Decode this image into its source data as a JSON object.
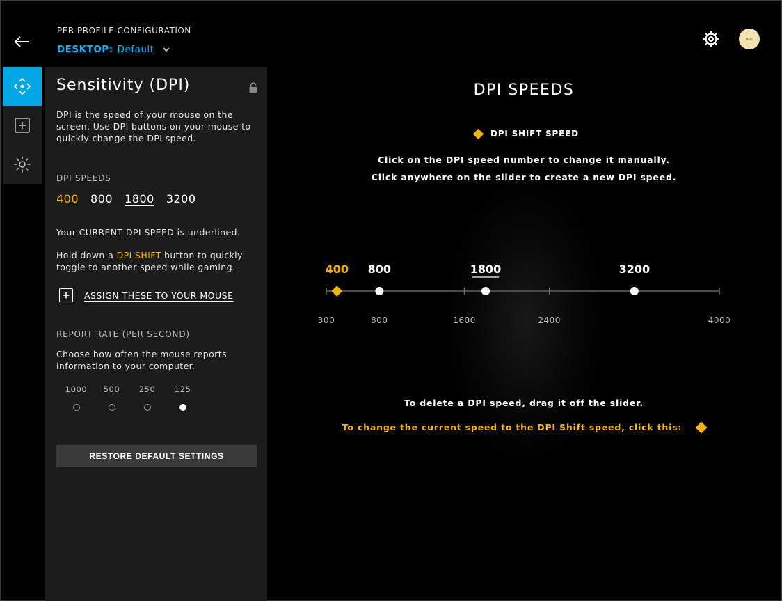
{
  "header": {
    "title": "PER-PROFILE CONFIGURATION",
    "profile_prefix": "DESKTOP:",
    "profile_name": "Default"
  },
  "avatar_text": "MALT",
  "panel": {
    "title": "Sensitivity (DPI)",
    "description": "DPI is the speed of your mouse on the screen. Use DPI buttons on your mouse to quickly change the DPI speed.",
    "dpi_section_label": "DPI SPEEDS",
    "dpi_speeds": [
      "400",
      "800",
      "1800",
      "3200"
    ],
    "current_note": "Your CURRENT DPI SPEED is underlined.",
    "shift_note_before": "Hold down a ",
    "shift_note_highlight": "DPI SHIFT",
    "shift_note_after": " button to quickly toggle to another speed while gaming.",
    "assign_label": "ASSIGN THESE TO YOUR MOUSE",
    "report_rate_label": "REPORT RATE (PER SECOND)",
    "report_rate_desc": "Choose how often the mouse reports information to your computer.",
    "report_rates": [
      "1000",
      "500",
      "250",
      "125"
    ],
    "report_rate_selected": "125",
    "restore_label": "RESTORE DEFAULT SETTINGS"
  },
  "main": {
    "title": "DPI SPEEDS",
    "shift_legend": "DPI SHIFT SPEED",
    "instruction_1": "Click on the DPI speed number to change it manually.",
    "instruction_2": "Click anywhere on the slider to create a new DPI speed.",
    "delete_hint": "To delete a DPI speed, drag it off the slider.",
    "shift_cta": "To change the current speed to the DPI Shift speed, click this:"
  },
  "colors": {
    "accent_blue": "#00b8fc",
    "shift_yellow": "#f8b400"
  },
  "icons": {
    "back": "arrow-left-icon",
    "settings": "gear-icon",
    "tool_pointer": "pointer-move-icon",
    "tool_assign": "plus-square-icon",
    "tool_lighting": "light-sun-icon",
    "lock": "lock-open-icon"
  },
  "chart_data": {
    "type": "slider",
    "min": 300,
    "max": 4000,
    "ticks": [
      300,
      800,
      1600,
      2400,
      4000
    ],
    "stops": [
      400,
      800,
      1800,
      3200
    ],
    "shift_speed": 400,
    "current_speed": 1800
  }
}
